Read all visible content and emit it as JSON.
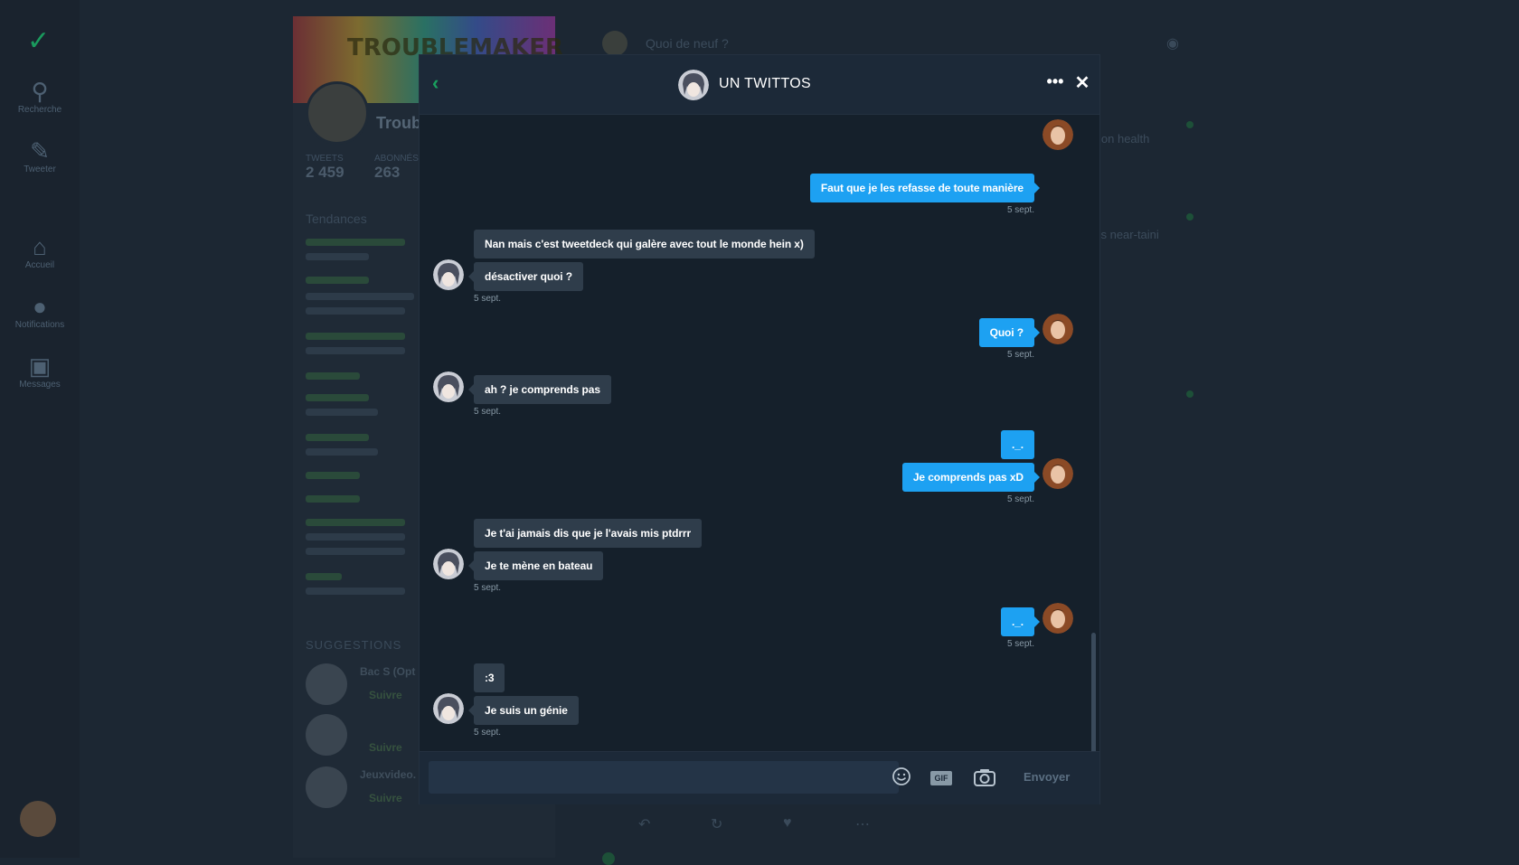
{
  "background": {
    "nav": [
      {
        "icon": "search-icon",
        "label": "Recherche"
      },
      {
        "icon": "compose-icon",
        "label": "Tweeter"
      },
      {
        "icon": "home-icon",
        "label": "Accueil"
      },
      {
        "icon": "bell-icon",
        "label": "Notifications"
      },
      {
        "icon": "inbox-icon",
        "label": "Messages"
      }
    ],
    "profile": {
      "banner_text": "TROUBLEMAKER",
      "name": "Troub",
      "stats": [
        {
          "label": "TWEETS",
          "value": "2 459"
        },
        {
          "label": "ABONNÉS",
          "value": "263"
        }
      ],
      "section_trends": "Tendances",
      "section_suggest": "SUGGESTIONS",
      "suggestions": [
        {
          "name": "Bac S (Opt",
          "action": "Suivre"
        },
        {
          "name": "",
          "action": "Suivre"
        },
        {
          "name": "Jeuxvideo.",
          "action": "Suivre"
        }
      ]
    },
    "feed": {
      "compose_placeholder": "Quoi de neuf ?",
      "snippets": [
        "ion health",
        "'s near-taini"
      ]
    }
  },
  "conversation": {
    "title": "UN TWITTOS",
    "back_icon": "chevron-left-icon",
    "more_icon": "more-dots-icon",
    "close_icon": "close-icon",
    "timestamp": "5 sept.",
    "messages": [
      {
        "side": "out",
        "text": "Faut que je les refasse de toute manière"
      },
      {
        "side": "in",
        "text": "Nan mais c'est tweetdeck qui galère avec tout le monde hein x)"
      },
      {
        "side": "in",
        "text": "désactiver quoi ?"
      },
      {
        "side": "out",
        "text": "Quoi ?"
      },
      {
        "side": "in",
        "text": "ah ? je comprends pas"
      },
      {
        "side": "out",
        "text": "._."
      },
      {
        "side": "out",
        "text": "Je comprends pas xD"
      },
      {
        "side": "in",
        "text": "Je t'ai jamais dis que je l'avais mis ptdrrr"
      },
      {
        "side": "in",
        "text": "Je te mène en bateau"
      },
      {
        "side": "out",
        "text": "._."
      },
      {
        "side": "in",
        "text": ":3"
      },
      {
        "side": "in",
        "text": "Je suis un génie"
      },
      {
        "side": "out",
        "text": "😂"
      }
    ]
  },
  "composer": {
    "value": "",
    "placeholder": "",
    "gif_label": "GIF",
    "send_label": "Envoyer",
    "emoji_icon": "smiley-icon",
    "photo_icon": "camera-icon"
  },
  "colors": {
    "accent_green": "#19a05e",
    "bubble_out": "#1da1f2",
    "bubble_in": "#2f3d4b",
    "modal_bg": "#15202b"
  }
}
